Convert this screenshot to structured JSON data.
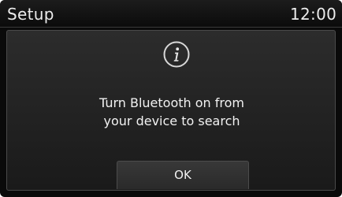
{
  "header": {
    "title": "Setup",
    "clock": "12:00"
  },
  "dialog": {
    "icon": "info-icon",
    "message": "Turn Bluetooth on from\nyour device to search",
    "ok_label": "OK"
  },
  "colors": {
    "background": "#0a0a0a",
    "dialog": "#262626",
    "text": "#f2f2f2"
  }
}
